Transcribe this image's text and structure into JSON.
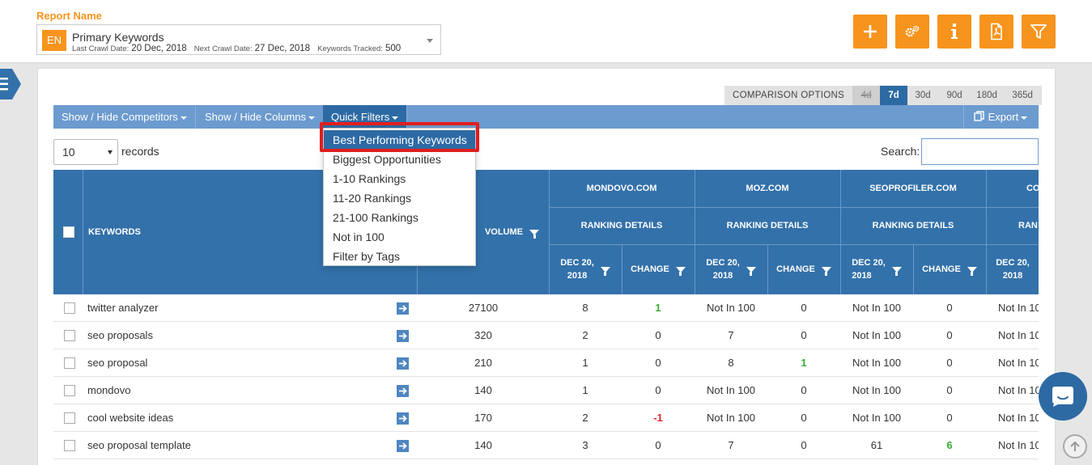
{
  "report": {
    "label": "Report Name",
    "lang": "EN",
    "title": "Primary Keywords",
    "last_crawl_label": "Last Crawl Date:",
    "last_crawl_value": "20 Dec, 2018",
    "next_crawl_label": "Next Crawl Date:",
    "next_crawl_value": "27 Dec, 2018",
    "tracked_label": "Keywords Tracked:",
    "tracked_value": "500"
  },
  "header_buttons": [
    "plus-icon",
    "gears-icon",
    "info-icon",
    "pdf-icon",
    "filter-icon"
  ],
  "comparison": {
    "label": "COMPARISON OPTIONS",
    "options": [
      "4d",
      "7d",
      "30d",
      "90d",
      "180d",
      "365d"
    ],
    "disabled": "4d",
    "active": "7d"
  },
  "toolbar": {
    "competitors": "Show / Hide Competitors",
    "columns": "Show / Hide Columns",
    "quick_filters": "Quick Filters",
    "export": "Export"
  },
  "table_controls": {
    "length_value": "10",
    "records_label": "records",
    "search_label": "Search:",
    "search_value": ""
  },
  "quick_filters": {
    "items": [
      "Best Performing Keywords",
      "Biggest Opportunities",
      "1-10 Rankings",
      "11-20 Rankings",
      "21-100 Rankings",
      "Not in 100",
      "Filter by Tags"
    ],
    "active_index": 0
  },
  "table_header": {
    "keywords": "KEYWORDS",
    "volume": "VOLUME",
    "ranking_details": "RANKING DETAILS",
    "date_line1": "DEC 20,",
    "date_line2": "2018",
    "change": "CHANGE",
    "competitors": [
      "MONDOVO.COM",
      "MOZ.COM",
      "SEOPROFILER.COM",
      "COGN"
    ]
  },
  "rows": [
    {
      "keyword": "twitter analyzer",
      "volume": "27100",
      "cols": [
        "8",
        "1",
        "Not In 100",
        "0",
        "Not In 100",
        "0",
        "Not In 10"
      ]
    },
    {
      "keyword": "seo proposals",
      "volume": "320",
      "cols": [
        "2",
        "0",
        "7",
        "0",
        "Not In 100",
        "0",
        "Not In 10"
      ]
    },
    {
      "keyword": "seo proposal",
      "volume": "210",
      "cols": [
        "1",
        "0",
        "8",
        "1",
        "Not In 100",
        "0",
        "Not In 10"
      ]
    },
    {
      "keyword": "mondovo",
      "volume": "140",
      "cols": [
        "1",
        "0",
        "Not In 100",
        "0",
        "Not In 100",
        "0",
        "Not In 10"
      ]
    },
    {
      "keyword": "cool website ideas",
      "volume": "170",
      "cols": [
        "2",
        "-1",
        "Not In 100",
        "0",
        "Not In 100",
        "0",
        "Not In 10"
      ]
    },
    {
      "keyword": "seo proposal template",
      "volume": "140",
      "cols": [
        "3",
        "0",
        "7",
        "0",
        "61",
        "6",
        "Not In 10"
      ]
    }
  ],
  "colors": {
    "accent": "#f7941d",
    "header_blue": "#3371aa",
    "toolbar_blue": "#6c9bcf",
    "active_blue": "#2d6aa3",
    "positive": "#3aaa35",
    "negative": "#d9252a",
    "highlight": "#e01e1e"
  }
}
